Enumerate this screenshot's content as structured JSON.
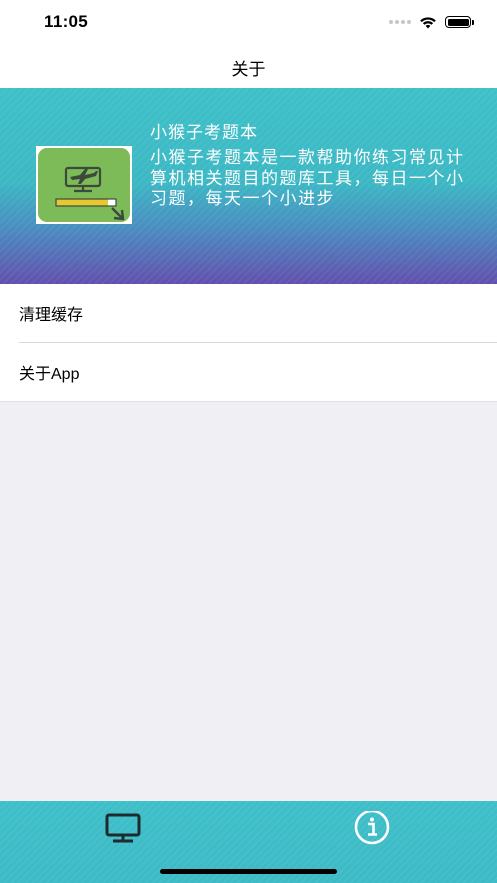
{
  "status_bar": {
    "time": "11:05",
    "signal_icon": "cellular-signal-icon",
    "wifi_icon": "wifi-icon",
    "battery_icon": "battery-icon"
  },
  "nav": {
    "title": "关于"
  },
  "header": {
    "app_icon": "app-logo-icon",
    "app_name": "小猴子考题本",
    "description": "小猴子考题本是一款帮助你练习常见计算机相关题目的题库工具，每日一个小习题，每天一个小进步",
    "colors": {
      "top": "#3ec0c8",
      "bottom": "#6250ad"
    }
  },
  "settings": {
    "items": [
      {
        "label": "清理缓存"
      },
      {
        "label": "关于App"
      }
    ]
  },
  "tab_bar": {
    "tabs": [
      {
        "icon": "monitor-icon",
        "selected": true
      },
      {
        "icon": "info-icon",
        "selected": false
      }
    ],
    "background": "#3cbac6"
  }
}
